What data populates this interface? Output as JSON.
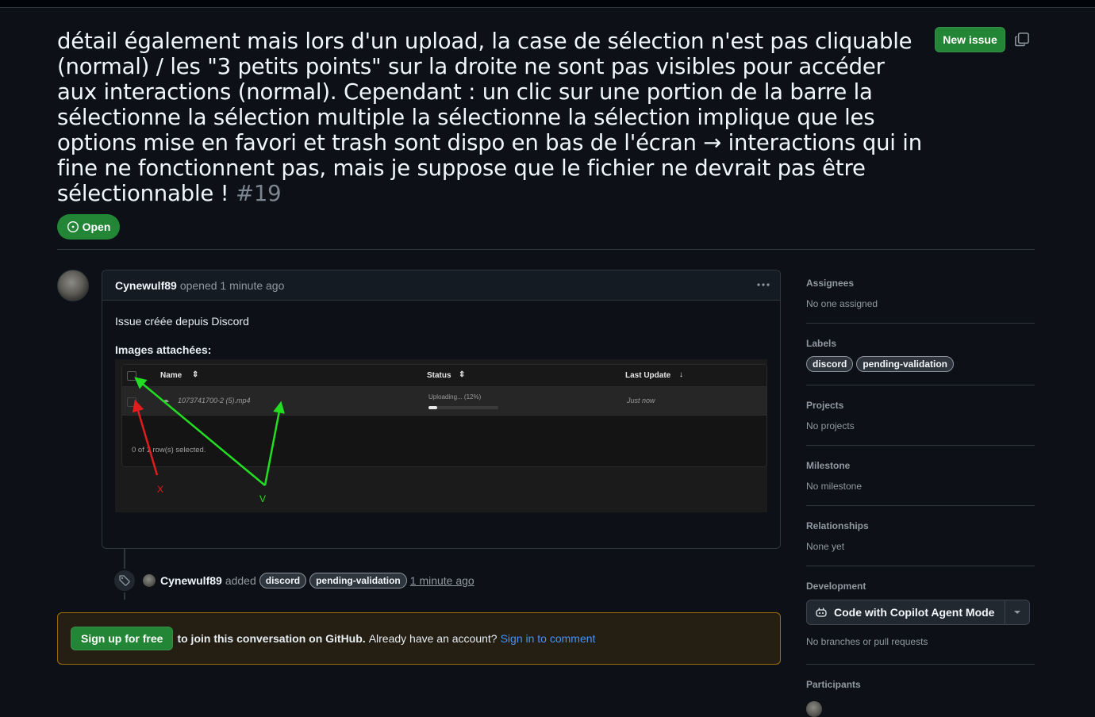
{
  "issue": {
    "title": "détail également mais lors d'un upload, la case de sélection n'est pas cliquable (normal) / les \"3 petits points\" sur la droite ne sont pas visibles pour accéder aux interactions (normal). Cependant : un clic sur une portion de la barre la sélectionne la sélection multiple la sélectionne la sélection implique que les options mise en favori et trash sont dispo en bas de l'écran → interactions qui in fine ne fonctionnent pas, mais je suppose que le fichier ne devrait pas être sélectionnable !",
    "number": "#19",
    "state": "Open",
    "new_issue_label": "New issue"
  },
  "comment": {
    "author": "Cynewulf89",
    "action": "opened",
    "time": "1 minute ago",
    "body": "Issue créée depuis Discord",
    "images_heading": "Images attachées:"
  },
  "screenshot": {
    "columns": [
      "Name",
      "Status",
      "Last Update"
    ],
    "file_name": "1073741700-2 (5).mp4",
    "status_text": "Uploading... (12%)",
    "progress": 0.12,
    "last_update": "Just now",
    "footer": "0 of 1 row(s) selected.",
    "mark_x": "X",
    "mark_v": "V"
  },
  "event": {
    "actor": "Cynewulf89",
    "action": "added",
    "labels": [
      "discord",
      "pending-validation"
    ],
    "time": "1 minute ago"
  },
  "signup": {
    "button": "Sign up for free",
    "text_bold": "to join this conversation on GitHub.",
    "text": "Already have an account?",
    "link": "Sign in to comment"
  },
  "sidebar": {
    "assignees": {
      "heading": "Assignees",
      "value": "No one assigned"
    },
    "labels": {
      "heading": "Labels",
      "items": [
        "discord",
        "pending-validation"
      ]
    },
    "projects": {
      "heading": "Projects",
      "value": "No projects"
    },
    "milestone": {
      "heading": "Milestone",
      "value": "No milestone"
    },
    "relationships": {
      "heading": "Relationships",
      "value": "None yet"
    },
    "development": {
      "heading": "Development",
      "button": "Code with Copilot Agent Mode",
      "value": "No branches or pull requests"
    },
    "participants": {
      "heading": "Participants"
    }
  },
  "colors": {
    "accent_green": "#238636",
    "link_blue": "#4493f8",
    "arrow_green": "#22dd22",
    "arrow_red": "#e01c1c"
  }
}
